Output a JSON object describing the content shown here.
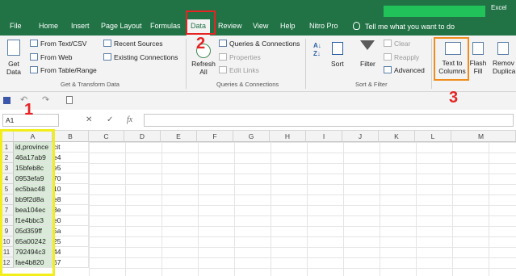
{
  "app_title": "Excel",
  "tabs": [
    "File",
    "Home",
    "Insert",
    "Page Layout",
    "Formulas",
    "Data",
    "Review",
    "View",
    "Help",
    "Nitro Pro"
  ],
  "active_tab": "Data",
  "tell_me": "Tell me what you want to do",
  "ribbon": {
    "get_data": [
      "Get",
      "Data"
    ],
    "from_text_csv": "From Text/CSV",
    "from_web": "From Web",
    "from_table_range": "From Table/Range",
    "recent_sources": "Recent Sources",
    "existing_connections": "Existing Connections",
    "group_get_transform": "Get & Transform Data",
    "refresh_all": [
      "Refresh",
      "All"
    ],
    "queries_connections": "Queries & Connections",
    "properties": "Properties",
    "edit_links": "Edit Links",
    "group_queries": "Queries & Connections",
    "sort": "Sort",
    "filter": "Filter",
    "clear": "Clear",
    "reapply": "Reapply",
    "advanced": "Advanced",
    "group_sort_filter": "Sort & Filter",
    "text_to_columns": [
      "Text to",
      "Columns"
    ],
    "flash_fill": [
      "Flash",
      "Fill"
    ],
    "remove_duplicates": [
      "Remov",
      "Duplica"
    ]
  },
  "formula_bar": {
    "name_box": "A1",
    "fx": "fx",
    "cancel": "✕",
    "enter": "✓"
  },
  "columns": [
    "A",
    "B",
    "C",
    "D",
    "E",
    "F",
    "G",
    "H",
    "I",
    "J",
    "K",
    "L",
    "M"
  ],
  "rows": [
    "1",
    "2",
    "3",
    "4",
    "5",
    "6",
    "7",
    "8",
    "9",
    "10",
    "11",
    "12"
  ],
  "column_a": [
    "id,province",
    "46a17ab9",
    "15bfeb8c",
    "0953efa9",
    "ec5bac48",
    "bb9f2d8a",
    "bea104ec",
    "f1e4bbc3",
    "05d359ff",
    "65a00242",
    "792494c3",
    "fae4b820"
  ],
  "column_b_overflow": [
    "cit",
    "e4",
    "e5",
    "70",
    "10",
    "e8",
    "3e",
    "e0",
    "5a",
    "25",
    "44",
    "67"
  ],
  "callouts": [
    "1",
    "2",
    "3"
  ]
}
